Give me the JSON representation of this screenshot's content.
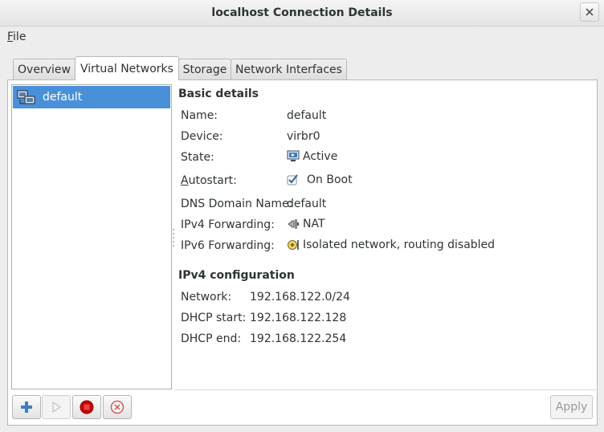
{
  "window": {
    "title": "localhost Connection Details"
  },
  "menu": {
    "file_first": "F",
    "file_rest": "ile"
  },
  "tabs": [
    {
      "label": "Overview"
    },
    {
      "label": "Virtual Networks"
    },
    {
      "label": "Storage"
    },
    {
      "label": "Network Interfaces"
    }
  ],
  "networks": [
    {
      "name": "default"
    }
  ],
  "basic": {
    "heading": "Basic details",
    "name_label": "Name:",
    "name_value": "default",
    "device_label": "Device:",
    "device_value": "virbr0",
    "state_label": "State:",
    "state_value": "Active",
    "autostart_first": "A",
    "autostart_rest": "utostart:",
    "autostart_value": "On Boot",
    "dns_label": "DNS Domain Name:",
    "dns_value": "default",
    "ipv4fwd_label": "IPv4 Forwarding:",
    "ipv4fwd_value": "NAT",
    "ipv6fwd_label": "IPv6 Forwarding:",
    "ipv6fwd_value": "Isolated network, routing disabled"
  },
  "ipv4": {
    "heading": "IPv4 configuration",
    "network_label": "Network:",
    "network_value": "192.168.122.0/24",
    "dhcp_start_label": "DHCP start:",
    "dhcp_start_value": "192.168.122.128",
    "dhcp_end_label": "DHCP end:",
    "dhcp_end_value": "192.168.122.254"
  },
  "buttons": {
    "apply": "Apply"
  },
  "colors": {
    "selection": "#4a90d9",
    "accent_blue": "#3b7fc4",
    "stop_red": "#cc0000"
  }
}
